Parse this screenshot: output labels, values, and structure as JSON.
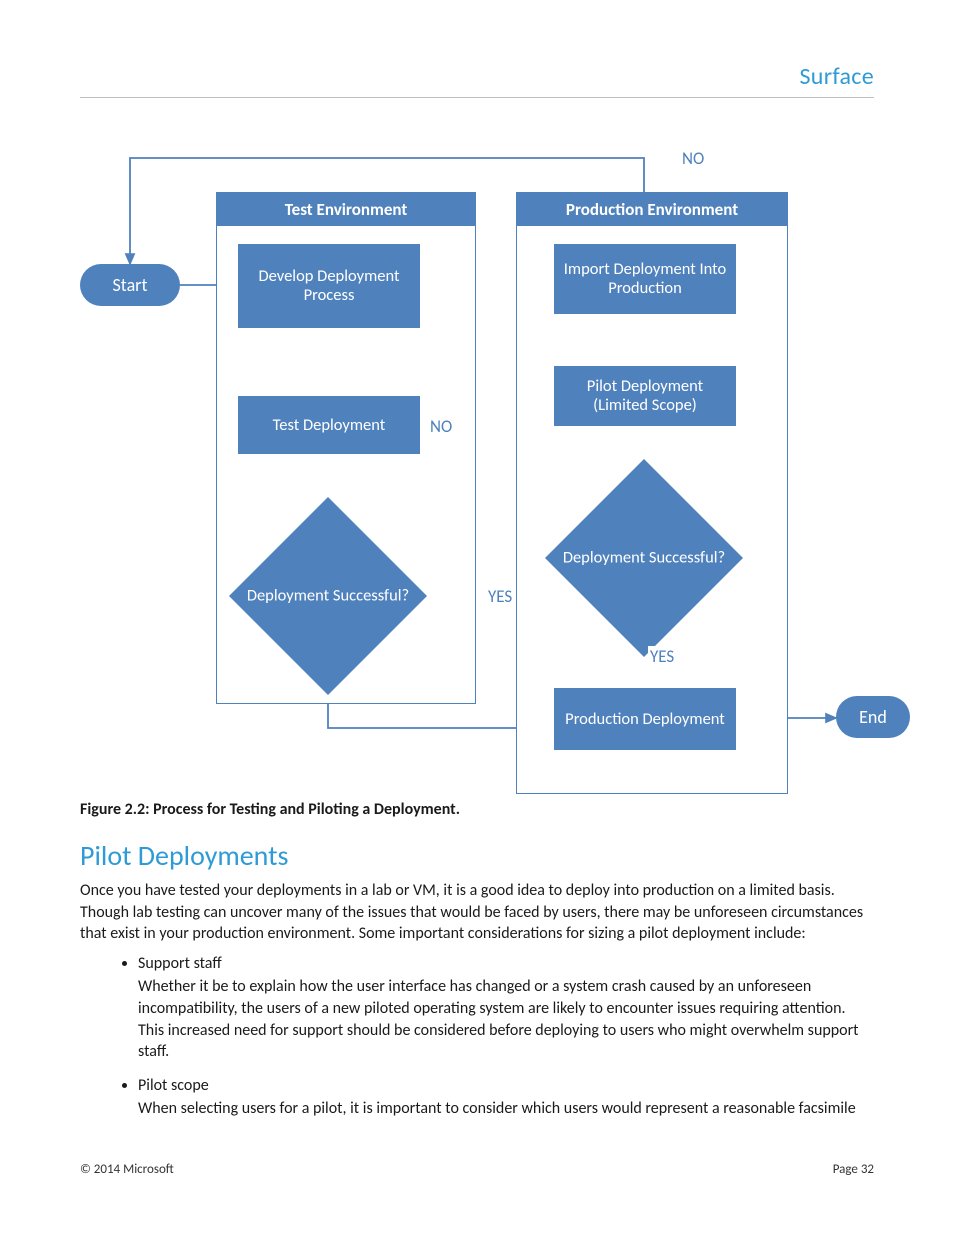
{
  "header": {
    "brand": "Surface"
  },
  "diagram": {
    "start": "Start",
    "end": "End",
    "test_env": {
      "title": "Test Environment",
      "develop": "Develop Deployment Process",
      "test": "Test Deployment",
      "decision": "Deployment Successful?"
    },
    "prod_env": {
      "title": "Production Environment",
      "import": "Import Deployment Into Production",
      "pilot": "Pilot Deployment (Limited Scope)",
      "decision": "Deployment Successful?",
      "prod_deploy": "Production Deployment"
    },
    "labels": {
      "no_loop_test": "NO",
      "yes_to_prod": "YES",
      "no_back_start": "NO",
      "yes_prod": "YES"
    }
  },
  "caption": "Figure 2.2: Process for Testing and Piloting a Deployment.",
  "section_heading": "Pilot Deployments",
  "intro": "Once you have tested your deployments in a lab or VM, it is a good idea to deploy into production on a limited basis. Though lab testing can uncover many of the issues that would be faced by users, there may be unforeseen circumstances that exist in your production environment. Some important considerations for sizing a pilot deployment include:",
  "bullets": [
    {
      "title": "Support staff",
      "body": "Whether it be to explain how the user interface has changed or a system crash caused by an unforeseen incompatibility, the users of a new piloted operating system are likely to encounter issues requiring attention. This increased need for support should be considered before deploying to users who might overwhelm support staff."
    },
    {
      "title": "Pilot scope",
      "body": "When selecting users for a pilot, it is important to consider which users would represent a reasonable facsimile"
    }
  ],
  "footer": {
    "copyright": "© 2014 Microsoft",
    "page": "Page 32"
  }
}
